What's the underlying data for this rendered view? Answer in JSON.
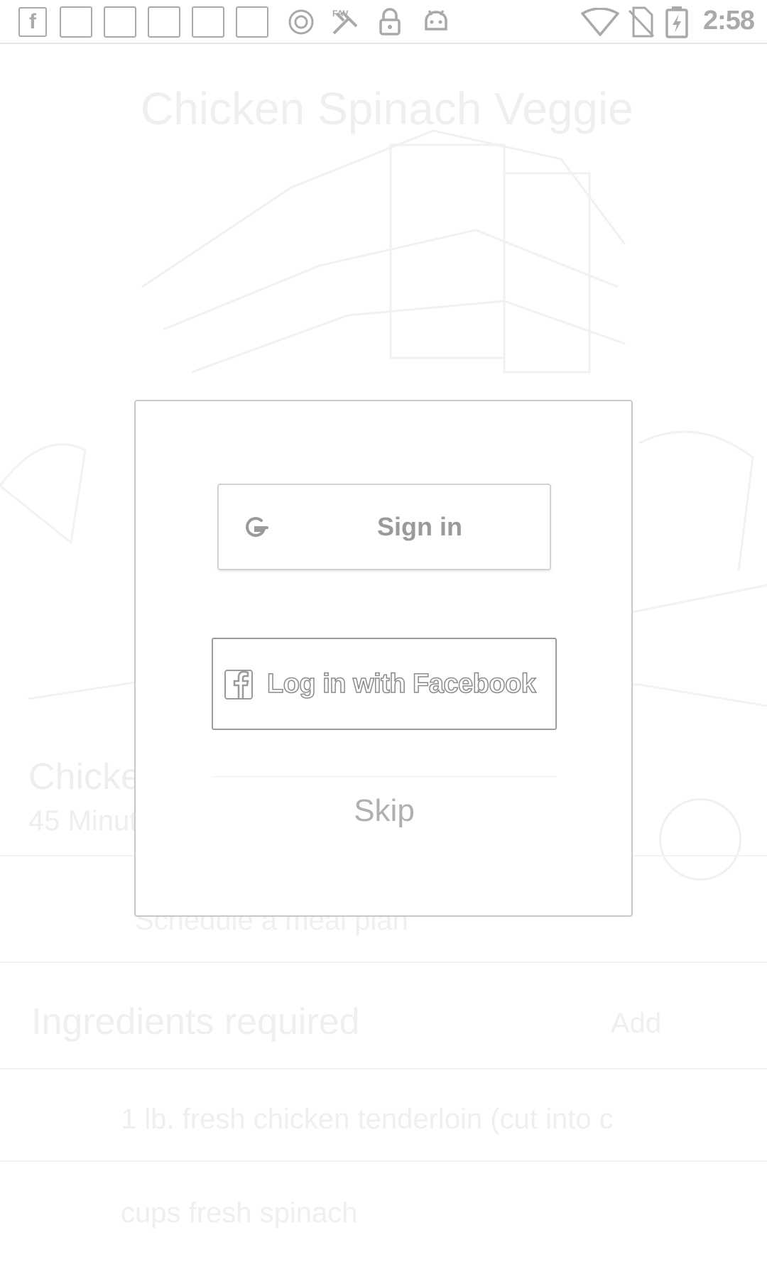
{
  "status_bar": {
    "time": "2:58",
    "icons": [
      "facebook-notification-icon",
      "notification-icon",
      "notification-icon",
      "notification-icon",
      "notification-icon",
      "notification-icon",
      "sync-icon",
      "satellite-icon",
      "lock-icon",
      "android-icon",
      "wifi-icon",
      "no-sim-icon",
      "battery-charging-icon"
    ]
  },
  "background": {
    "title": "Chicken Spinach Veggie",
    "recipe_title": "Chicken",
    "time": "45 Minutes",
    "schedule": "Schedule a meal plan",
    "ingredients_heading": "Ingredients required",
    "add_label": "Add",
    "items": [
      "1 lb. fresh chicken tenderloin (cut into c",
      "cups fresh spinach"
    ]
  },
  "dialog": {
    "google_button_label": "Sign in",
    "facebook_button_label": "Log in with Facebook",
    "skip_label": "Skip"
  }
}
